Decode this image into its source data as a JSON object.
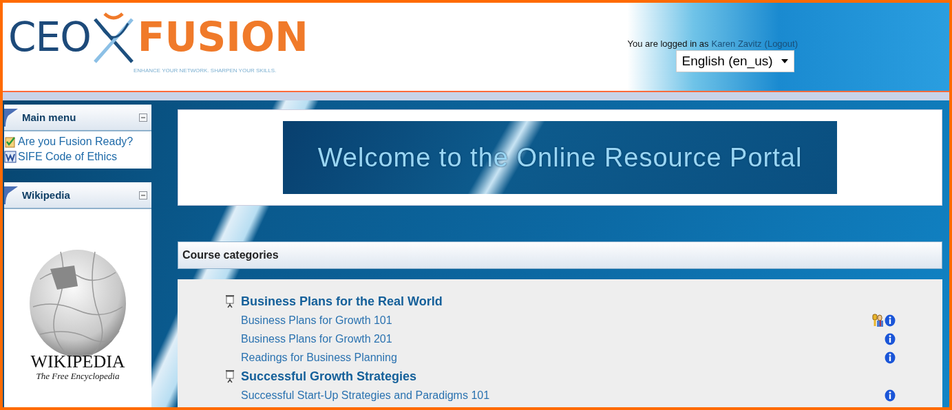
{
  "header": {
    "logo": {
      "left": "CEO",
      "right": "FUSION",
      "tagline": "ENHANCE YOUR NETWORK. SHARPEN YOUR SKILLS."
    },
    "login": {
      "prefix": "You are logged in as",
      "user": "Karen Zavitz",
      "logout": "(Logout)"
    },
    "language": "English (en_us)"
  },
  "sidebar": [
    {
      "kind": "links",
      "title": "Main menu",
      "items": [
        {
          "kind": "quiz",
          "label": "Are you Fusion Ready?"
        },
        {
          "kind": "word",
          "label": "SIFE Code of Ethics"
        }
      ]
    },
    {
      "kind": "image",
      "title": "Wikipedia",
      "caption_title": "WIKIPEDIA",
      "caption_sub": "The Free Encyclopedia"
    }
  ],
  "banner": "Welcome to the Online Resource Portal",
  "course_categories": {
    "title": "Course categories",
    "categories": [
      {
        "name": "Business Plans for the Real World",
        "courses": [
          {
            "name": "Business Plans for Growth 101",
            "icons": [
              {
                "kind": "guest"
              },
              {
                "kind": "info"
              }
            ]
          },
          {
            "name": "Business Plans for Growth 201",
            "icons": [
              {
                "kind": "info"
              }
            ]
          },
          {
            "name": "Readings for Business Planning",
            "icons": [
              {
                "kind": "info"
              }
            ]
          }
        ]
      },
      {
        "name": "Successful Growth Strategies",
        "courses": [
          {
            "name": "Successful Start-Up Strategies and Paradigms 101",
            "icons": [
              {
                "kind": "info"
              }
            ]
          }
        ]
      }
    ]
  }
}
